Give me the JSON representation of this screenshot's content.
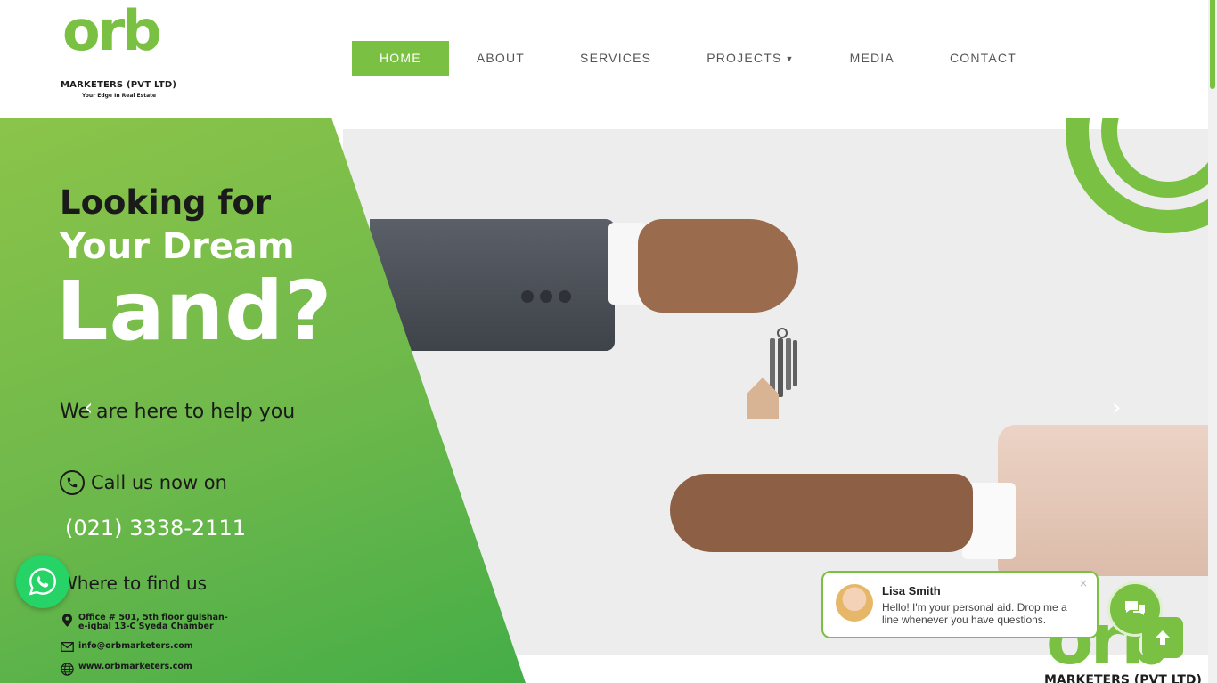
{
  "header": {
    "logo": {
      "brand": "orb",
      "subtitle": "MARKETERS (PVT LTD)",
      "tagline": "Your Edge In Real Estate"
    },
    "nav": [
      {
        "label": "HOME",
        "active": true
      },
      {
        "label": "ABOUT"
      },
      {
        "label": "SERVICES"
      },
      {
        "label": "PROJECTS",
        "has_dropdown": true
      },
      {
        "label": "MEDIA"
      },
      {
        "label": "CONTACT"
      }
    ]
  },
  "hero": {
    "line1": "Looking for",
    "line2": "Your Dream",
    "line3": "Land?",
    "help": "We are here to help you",
    "call_label": "Call us now on",
    "phone": "(021) 3338-2111",
    "where_label": "Where to find us",
    "address": "Office # 501, 5th floor gulshan-e-iqbal 13-C Syeda Chamber",
    "email": "info@orbmarketers.com",
    "website": "www.orbmarketers.com",
    "prev_arrow": "‹",
    "next_arrow": "›",
    "bottom_logo_brand": "orb",
    "bottom_logo_sub": "MARKETERS (PVT LTD)"
  },
  "chat": {
    "agent_name": "Lisa Smith",
    "message": "Hello! I'm your personal aid. Drop me a line whenever you have questions.",
    "close": "×"
  },
  "colors": {
    "brand_green": "#7ac143",
    "whatsapp_green": "#25d366",
    "text_dark": "#1a1a1a"
  },
  "icons": [
    "whatsapp-icon",
    "phone-icon",
    "location-pin-icon",
    "envelope-icon",
    "globe-icon",
    "chat-icon",
    "arrow-up-icon",
    "chevron-down-icon",
    "close-icon"
  ]
}
